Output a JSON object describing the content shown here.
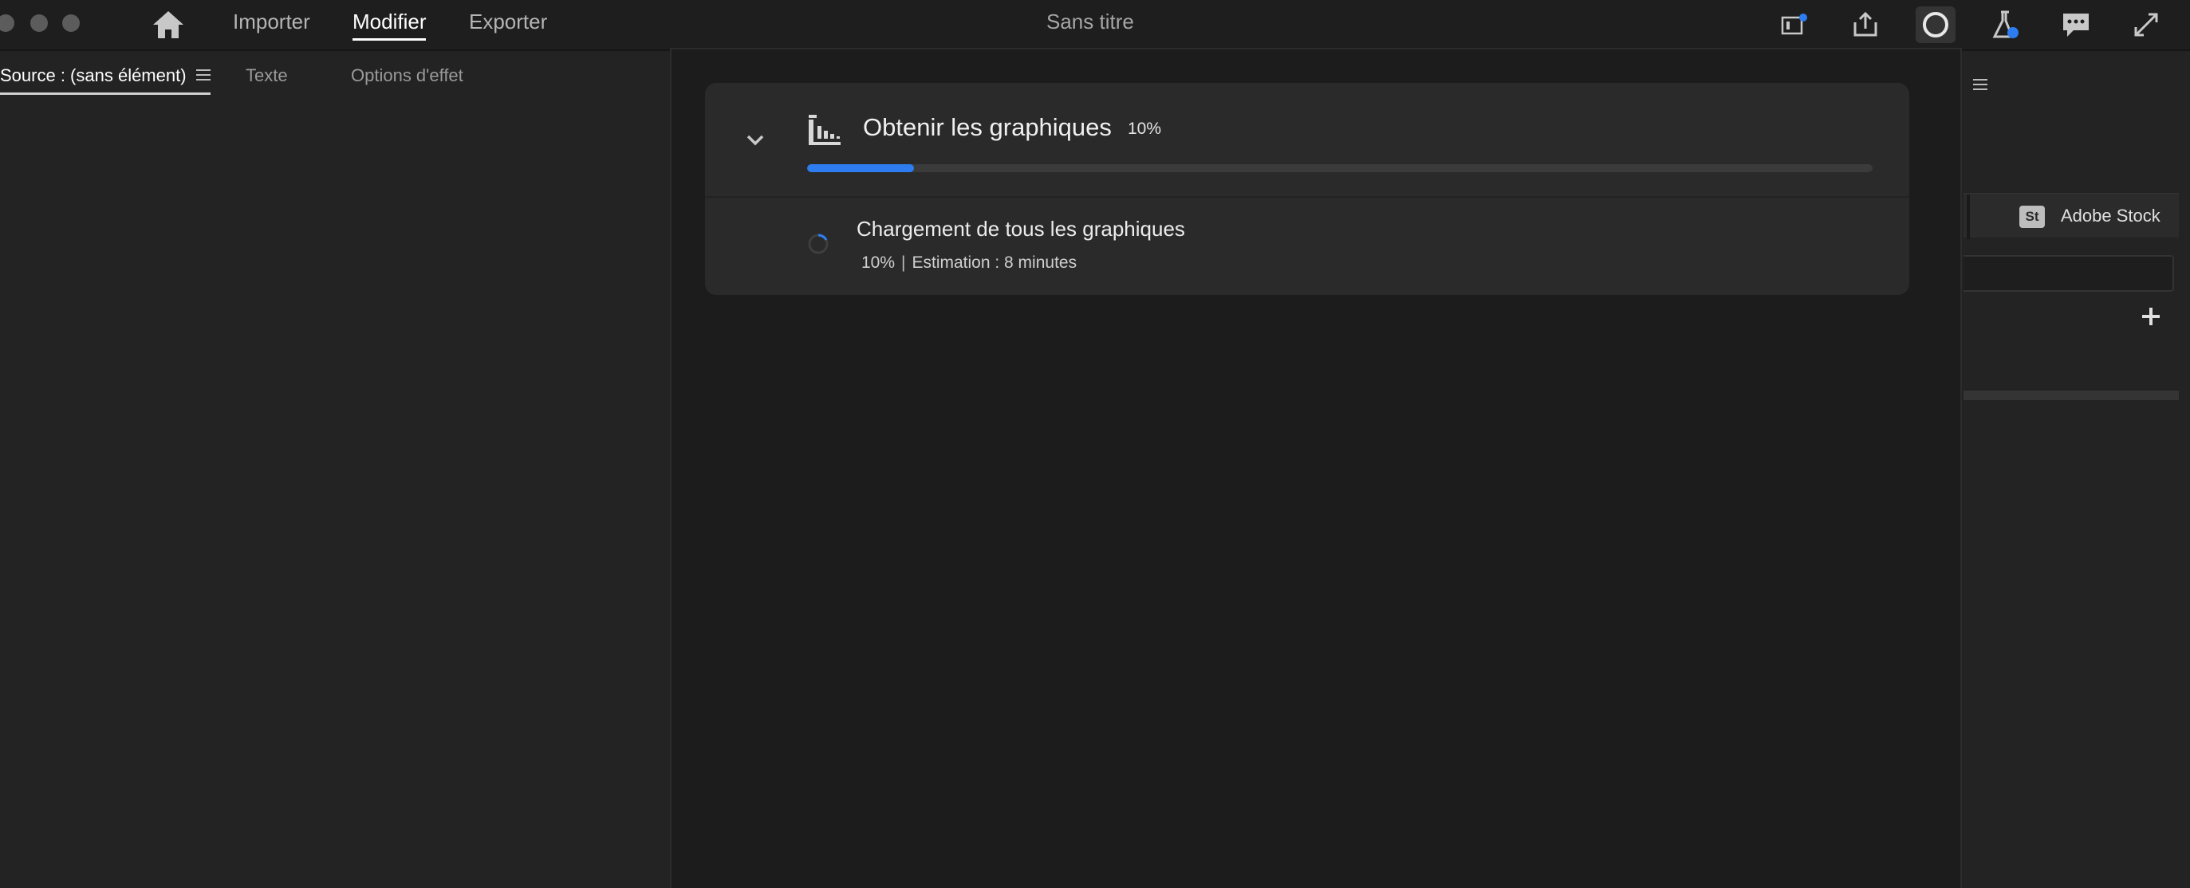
{
  "titlebar": {
    "nav": {
      "import": "Importer",
      "edit": "Modifier",
      "export": "Exporter"
    },
    "document_title": "Sans titre",
    "icons": [
      "home-icon",
      "workspace-notification-icon",
      "share-export-icon",
      "progress-ring-icon",
      "beta-labs-icon",
      "feedback-icon",
      "fullscreen-icon"
    ]
  },
  "left_panel": {
    "tabs": {
      "source": "Source : (sans élément)",
      "text": "Texte",
      "effects": "Options d'effet"
    }
  },
  "progress_card": {
    "title": "Obtenir les graphiques",
    "percent_label": "10%",
    "progress": 0.1,
    "task": {
      "title": "Chargement de tous les graphiques",
      "percent_label": "10%",
      "separator": "|",
      "estimate": "Estimation : 8 minutes"
    }
  },
  "right_panel": {
    "stock_badge": "St",
    "stock_label": "Adobe Stock"
  },
  "colors": {
    "accent": "#2d7df0",
    "background": "#232323",
    "overlay": "#1c1c1c",
    "card": "#2a2a2a"
  }
}
